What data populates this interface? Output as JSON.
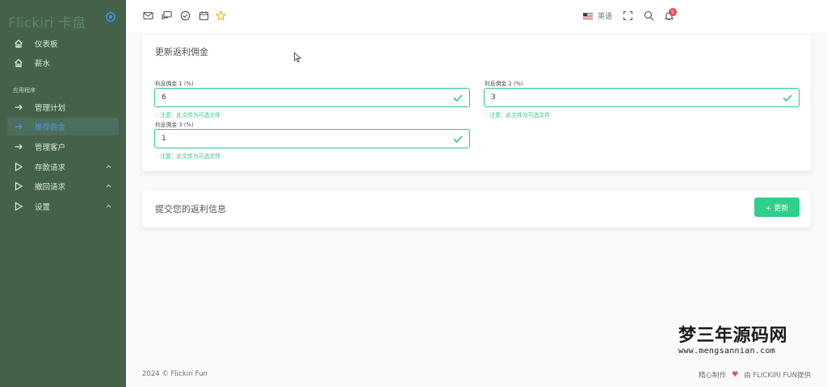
{
  "brand": {
    "name": "Flickiri 卡盘"
  },
  "sidebar": {
    "items": [
      {
        "label": "仪表板"
      },
      {
        "label": "薪水"
      }
    ],
    "section_label": "应用程序",
    "app_items": [
      {
        "label": "管理计划"
      },
      {
        "label": "推荐佣金"
      },
      {
        "label": "管理客户"
      },
      {
        "label": "存款请求"
      },
      {
        "label": "撤回请求"
      },
      {
        "label": "设置"
      }
    ]
  },
  "topbar": {
    "language": "英语",
    "notification_count": "5"
  },
  "form": {
    "title": "更新返利佣金",
    "fields": [
      {
        "label": "利息佣金 1 (%)",
        "value": "6",
        "help": "注意：此文件为可选文件"
      },
      {
        "label": "利息佣金 2 (%)",
        "value": "3",
        "help": "注意：此文件为可选文件"
      },
      {
        "label": "利息佣金 3 (%)",
        "value": "1",
        "help": "注意：此文件为可选文件"
      }
    ]
  },
  "submit": {
    "title": "提交您的返利信息",
    "button_label": "+ 更新"
  },
  "watermark": {
    "chinese": "梦三年源码网",
    "url": "www.mengsannian.com"
  },
  "footer": {
    "copyright": "2024 © Flickiri Fun",
    "made_prefix": "精心制作",
    "made_suffix": "由 FLICKIRI FUN提供"
  },
  "colors": {
    "sidebar_bg": "#45614a",
    "accent_green": "#30c783",
    "active_blue": "#4a9be0",
    "badge_red": "#e5484d"
  }
}
